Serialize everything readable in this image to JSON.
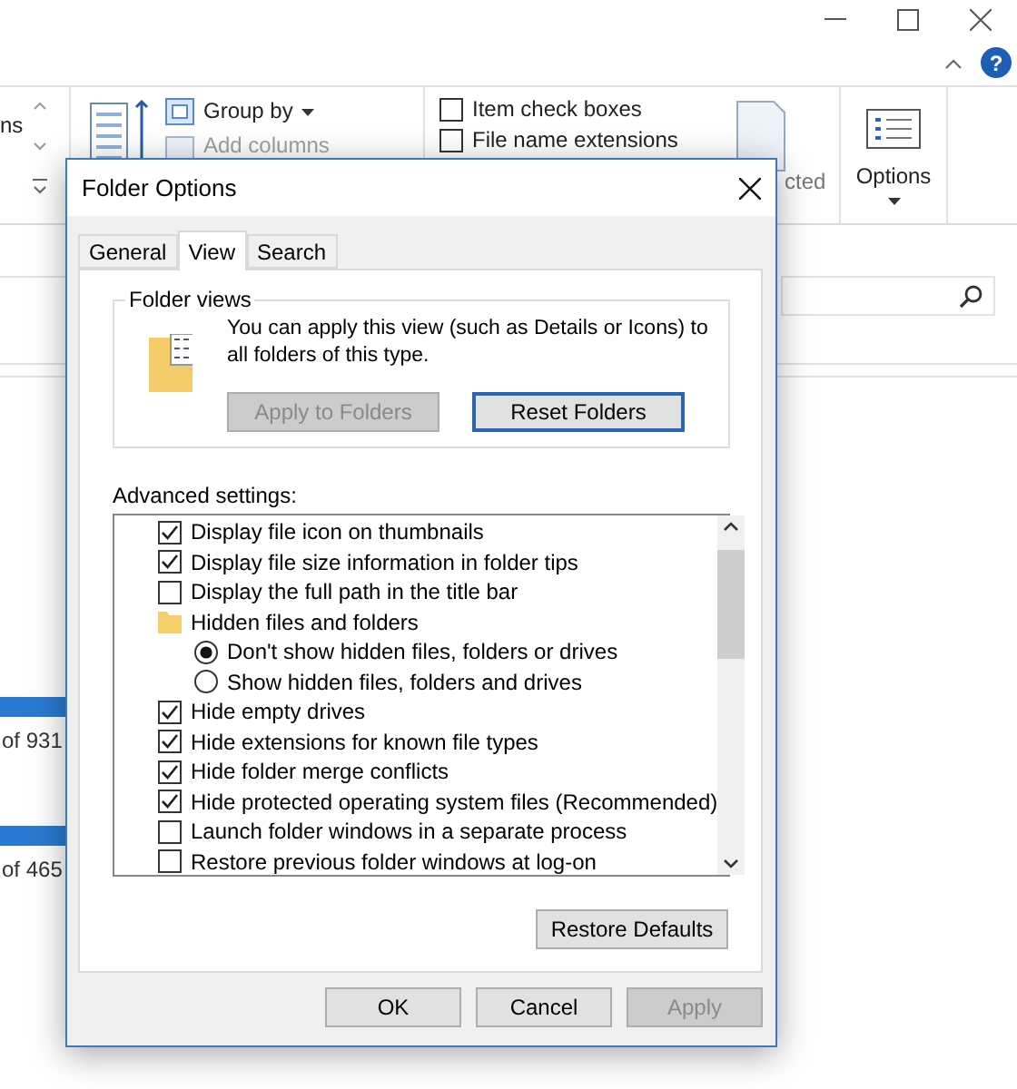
{
  "explorer": {
    "help_label": "?",
    "ribbon": {
      "layout_cut_label": "ns",
      "group_by": "Group by",
      "add_columns": "Add columns",
      "checkboxes": [
        {
          "label": "Item check boxes",
          "checked": false
        },
        {
          "label": "File name extensions",
          "checked": false
        }
      ],
      "hide_selected_cut_label": "cted",
      "options": "Options"
    },
    "drives": [
      {
        "caption": "of 931"
      },
      {
        "caption": "of 465"
      }
    ]
  },
  "dialog": {
    "title": "Folder Options",
    "tabs": [
      {
        "label": "General",
        "selected": false
      },
      {
        "label": "View",
        "selected": true
      },
      {
        "label": "Search",
        "selected": false
      }
    ],
    "folder_views": {
      "title": "Folder views",
      "text": "You can apply this view (such as Details or Icons) to all folders of this type.",
      "buttons": [
        {
          "label": "Apply to Folders",
          "disabled": true,
          "is_default": false
        },
        {
          "label": "Reset Folders",
          "disabled": false,
          "is_default": true
        }
      ]
    },
    "advanced_label": "Advanced settings:",
    "settings": [
      {
        "kind": "checkbox",
        "label": "Display file icon on thumbnails",
        "checked": true
      },
      {
        "kind": "checkbox",
        "label": "Display file size information in folder tips",
        "checked": true
      },
      {
        "kind": "checkbox",
        "label": "Display the full path in the title bar",
        "checked": false
      },
      {
        "kind": "folder",
        "label": "Hidden files and folders",
        "children": [
          {
            "kind": "radio",
            "label": "Don't show hidden files, folders or drives",
            "selected": true
          },
          {
            "kind": "radio",
            "label": "Show hidden files, folders and drives",
            "selected": false
          }
        ]
      },
      {
        "kind": "checkbox",
        "label": "Hide empty drives",
        "checked": true
      },
      {
        "kind": "checkbox",
        "label": "Hide extensions for known file types",
        "checked": true
      },
      {
        "kind": "checkbox",
        "label": "Hide folder merge conflicts",
        "checked": true
      },
      {
        "kind": "checkbox",
        "label": "Hide protected operating system files (Recommended)",
        "checked": true
      },
      {
        "kind": "checkbox",
        "label": "Launch folder windows in a separate process",
        "checked": false
      },
      {
        "kind": "checkbox",
        "label": "Restore previous folder windows at log-on",
        "checked": false
      }
    ],
    "restore_defaults": "Restore Defaults",
    "buttons": [
      {
        "label": "OK",
        "disabled": false
      },
      {
        "label": "Cancel",
        "disabled": false
      },
      {
        "label": "Apply",
        "disabled": true
      }
    ]
  }
}
